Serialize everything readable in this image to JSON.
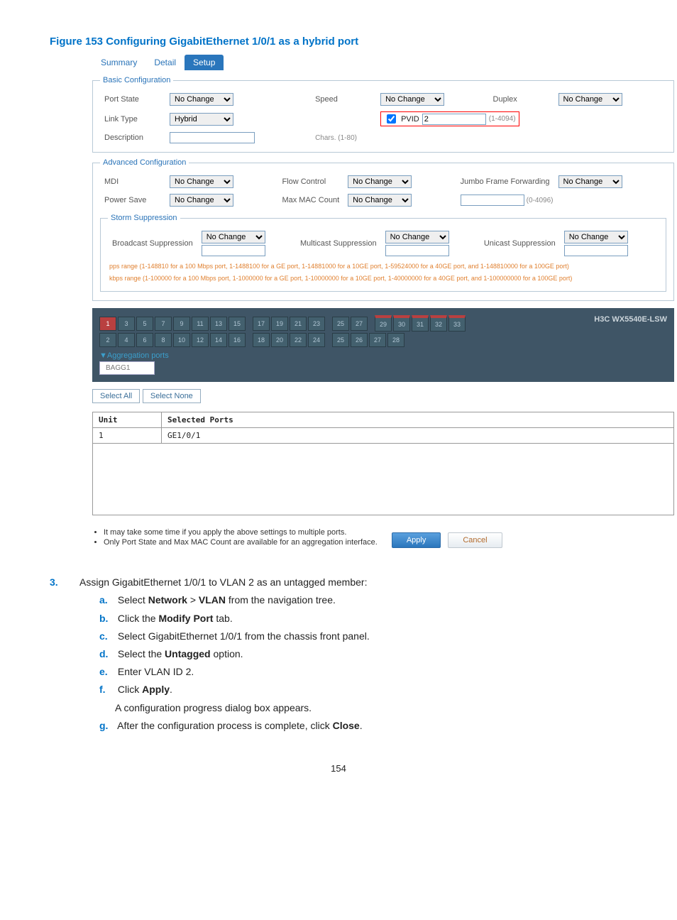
{
  "figure": {
    "title": "Figure 153 Configuring GigabitEthernet 1/0/1 as a hybrid port"
  },
  "tabs": {
    "summary": "Summary",
    "detail": "Detail",
    "setup": "Setup"
  },
  "fieldset": {
    "basic": "Basic Configuration",
    "advanced": "Advanced Configuration",
    "storm": "Storm Suppression"
  },
  "labels": {
    "port_state": "Port State",
    "speed": "Speed",
    "duplex": "Duplex",
    "link_type": "Link Type",
    "pvid": "PVID",
    "description": "Description",
    "chars": "Chars. (1-80)",
    "mdi": "MDI",
    "flow": "Flow Control",
    "jumbo": "Jumbo Frame Forwarding",
    "power": "Power Save",
    "maxmac": "Max MAC Count",
    "broadcast": "Broadcast Suppression",
    "multicast": "Multicast Suppression",
    "unicast": "Unicast Suppression"
  },
  "values": {
    "no_change": "No Change",
    "hybrid": "Hybrid",
    "pvid_val": "2",
    "pvid_range": "(1-4094)",
    "maxmac_range": "(0-4096)"
  },
  "hint1": "pps range (1-148810 for a 100 Mbps port, 1-1488100 for a GE port, 1-14881000 for a 10GE port, 1-59524000 for a 40GE port, and 1-148810000 for a 100GE port)",
  "hint2": "kbps range (1-100000 for a 100 Mbps port, 1-1000000 for a GE port, 1-10000000 for a 10GE port, 1-40000000 for a 40GE port, and 1-100000000 for a 100GE port)",
  "chassis": {
    "device": "H3C WX5540E-LSW",
    "agg_title": "Aggregation ports",
    "agg_item": "BAGG1",
    "top": [
      "1",
      "3",
      "5",
      "7",
      "9",
      "11",
      "13",
      "15",
      "17",
      "19",
      "21",
      "23",
      "25",
      "27",
      "29",
      "30",
      "31",
      "32",
      "33"
    ],
    "bottom": [
      "2",
      "4",
      "6",
      "8",
      "10",
      "12",
      "14",
      "16",
      "18",
      "20",
      "22",
      "24",
      "25",
      "26",
      "27",
      "28"
    ]
  },
  "buttons": {
    "select_all": "Select All",
    "select_none": "Select None",
    "apply": "Apply",
    "cancel": "Cancel"
  },
  "table": {
    "unit_hdr": "Unit",
    "sel_hdr": "Selected Ports",
    "unit_val": "1",
    "sel_val": "GE1/0/1"
  },
  "notes": {
    "n1": "It may take some time if you apply the above settings to multiple ports.",
    "n2": "Only Port State and Max MAC Count are available for an aggregation interface."
  },
  "instructions": {
    "step3": "Assign GigabitEthernet 1/0/1 to VLAN 2 as an untagged member:",
    "a_pre": "Select ",
    "a_b1": "Network",
    "a_mid": " > ",
    "a_b2": "VLAN",
    "a_post": " from the navigation tree.",
    "b_pre": "Click the ",
    "b_b": "Modify Port",
    "b_post": " tab.",
    "c": "Select GigabitEthernet 1/0/1 from the chassis front panel.",
    "d_pre": "Select the ",
    "d_b": "Untagged",
    "d_post": " option.",
    "e": "Enter VLAN ID 2.",
    "f_pre": "Click ",
    "f_b": "Apply",
    "f_post": ".",
    "f_note": "A configuration progress dialog box appears.",
    "g_pre": "After the configuration process is complete, click ",
    "g_b": "Close",
    "g_post": "."
  },
  "page": "154"
}
